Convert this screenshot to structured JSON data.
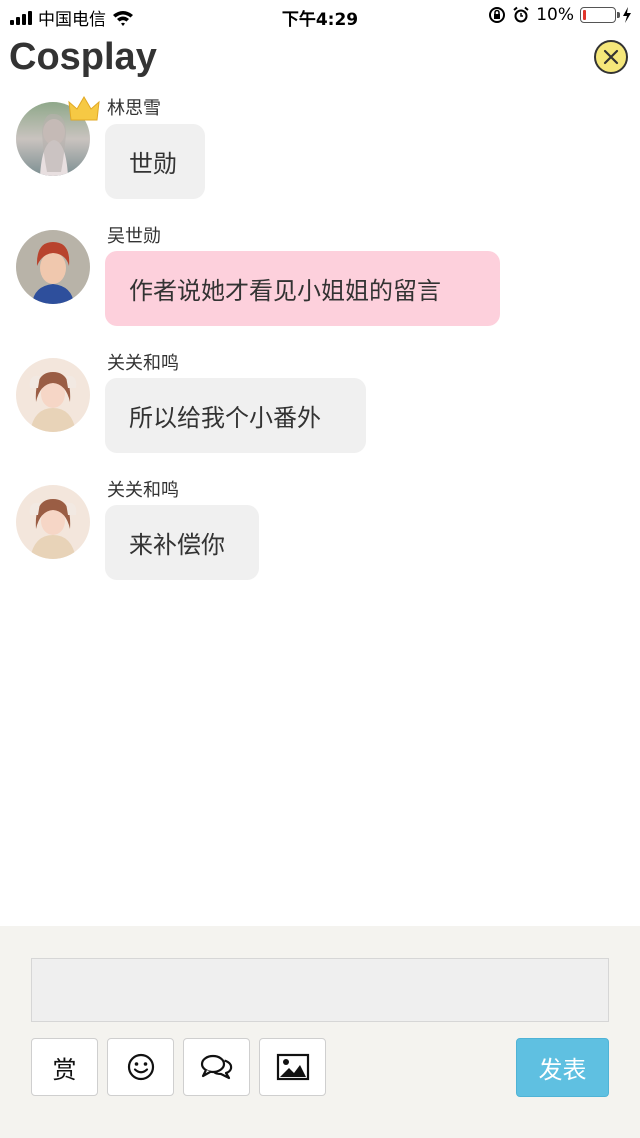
{
  "status_bar": {
    "carrier": "中国电信",
    "time": "下午4:29",
    "battery_percent": "10%",
    "battery_level": 0.1
  },
  "header": {
    "title": "Cosplay",
    "close_icon": "close-circle-icon"
  },
  "messages": [
    {
      "sender": "林思雪",
      "text": "世勋",
      "highlight": false,
      "crown": true
    },
    {
      "sender": "吴世勋",
      "text": "作者说她才看见小姐姐的留言",
      "highlight": true,
      "crown": false
    },
    {
      "sender": "关关和鸣",
      "text": "所以给我个小番外",
      "highlight": false,
      "crown": false
    },
    {
      "sender": "关关和鸣",
      "text": "来补偿你",
      "highlight": false,
      "crown": false
    }
  ],
  "composer": {
    "input_value": "",
    "reward_label": "赏",
    "emoji_icon": "smiley-icon",
    "chat_icon": "speech-bubbles-icon",
    "image_icon": "picture-icon",
    "send_label": "发表"
  },
  "colors": {
    "highlight_bubble": "#fdd0dc",
    "normal_bubble": "#f0f0f0",
    "send_button": "#5fc0e1",
    "close_button": "#f5e77a"
  }
}
